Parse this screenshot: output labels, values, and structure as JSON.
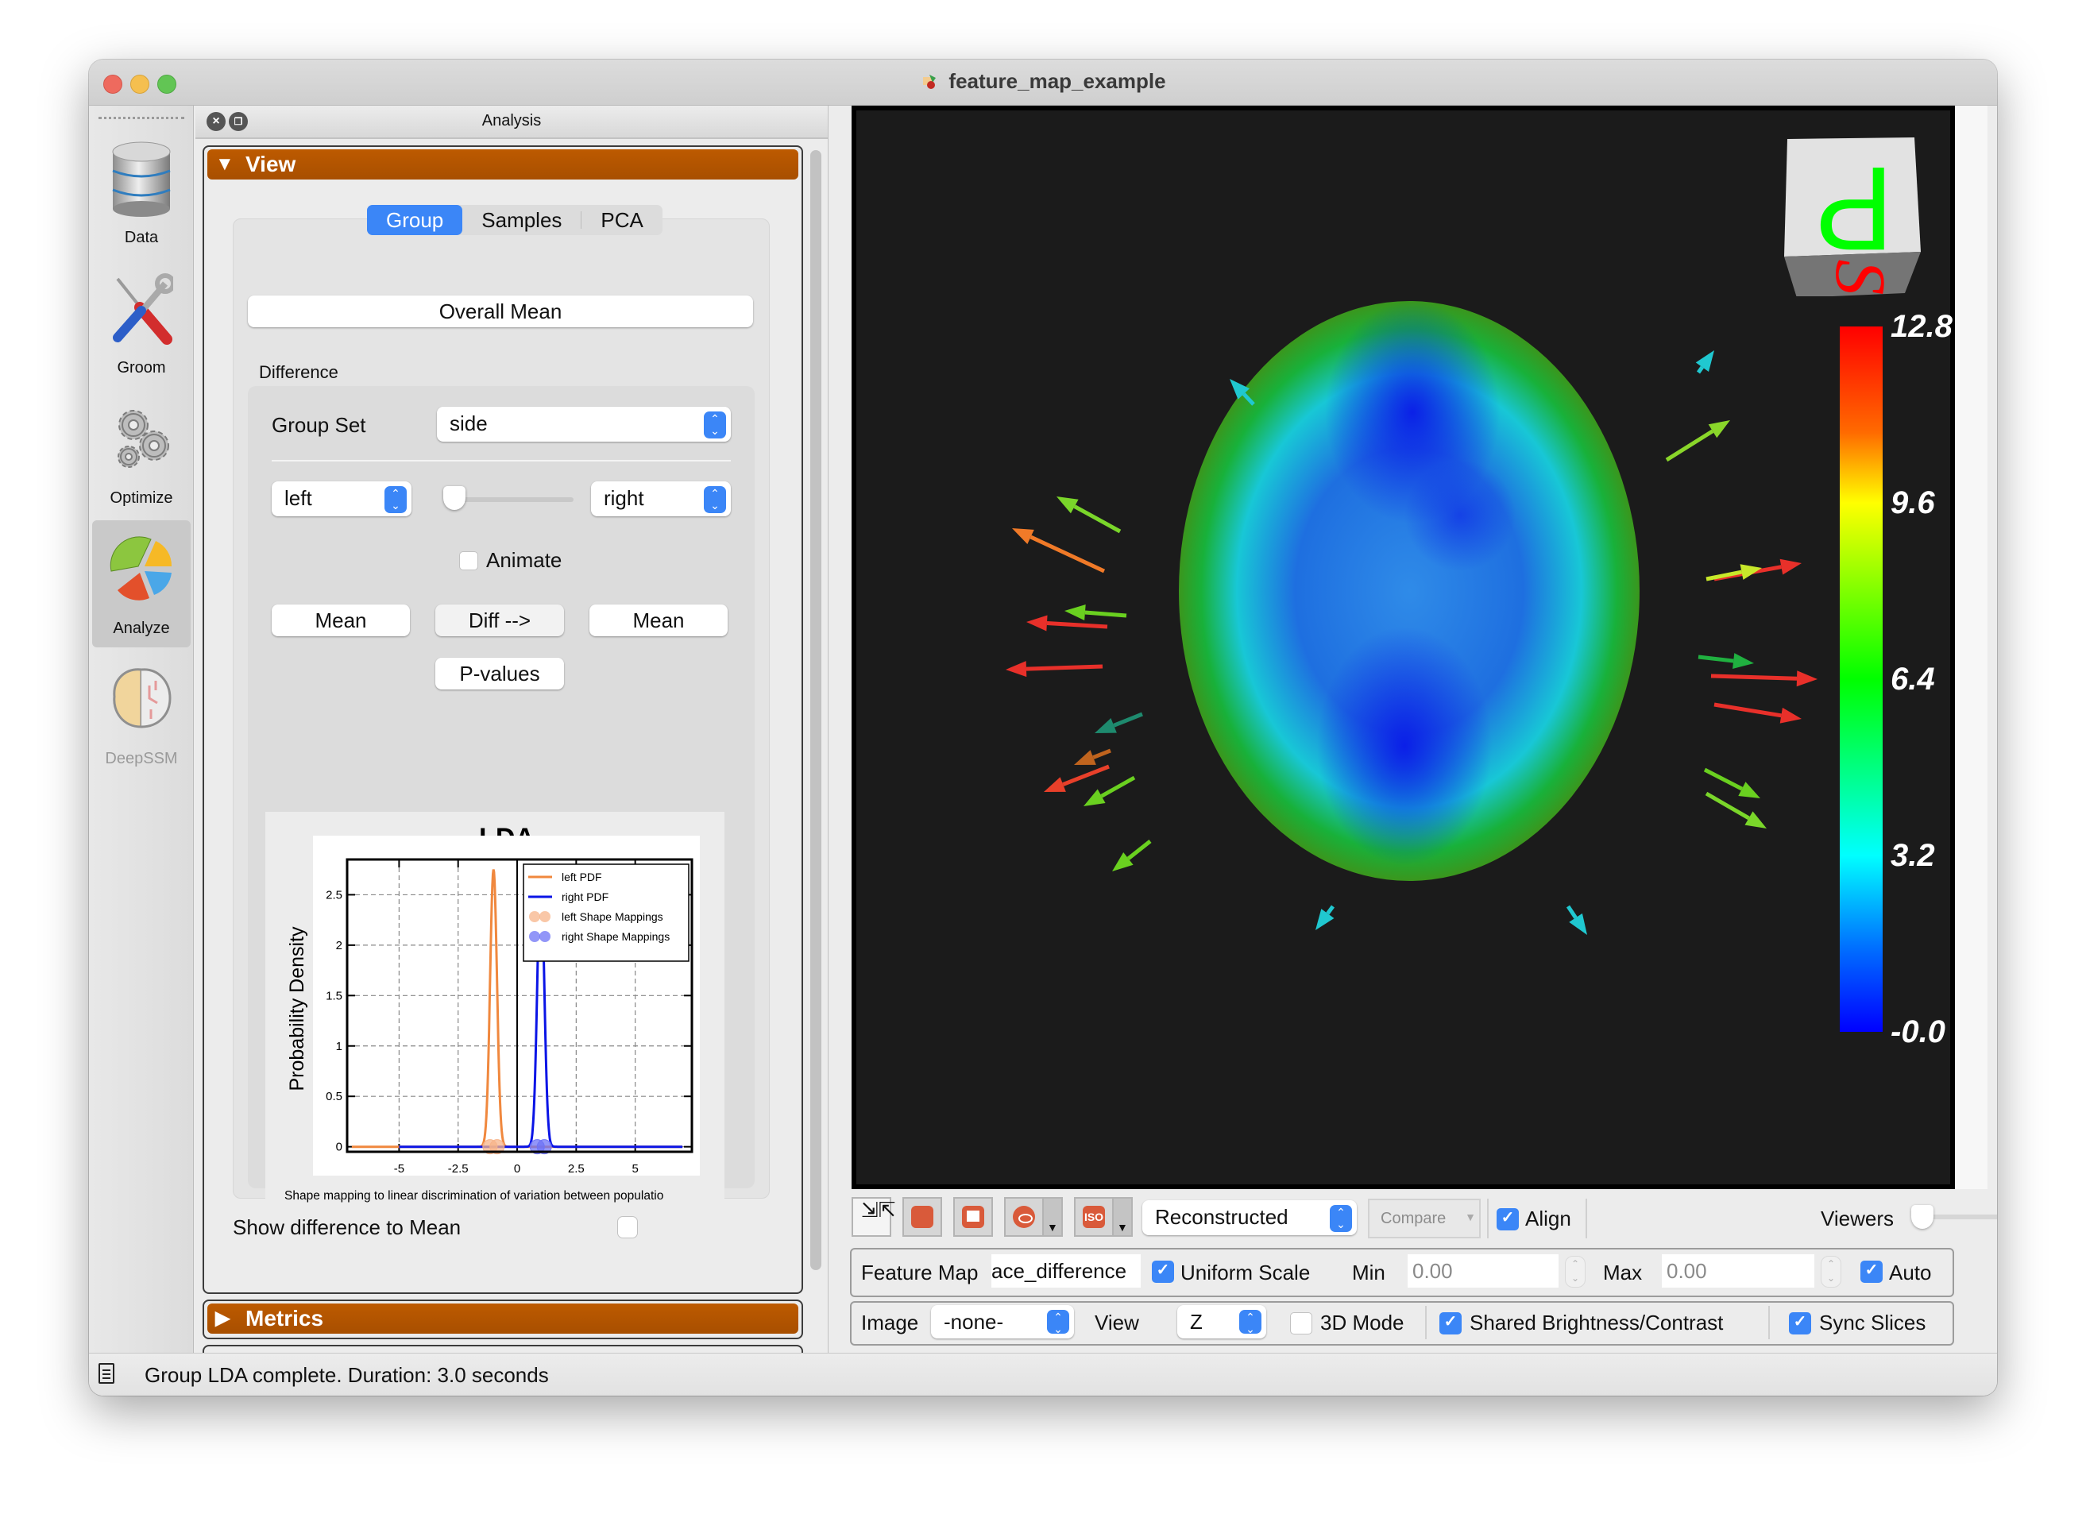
{
  "window": {
    "title": "feature_map_example"
  },
  "sidebar": {
    "items": [
      {
        "label": "Data",
        "icon": "database-icon",
        "active": false,
        "enabled": true
      },
      {
        "label": "Groom",
        "icon": "tools-icon",
        "active": false,
        "enabled": true
      },
      {
        "label": "Optimize",
        "icon": "gears-icon",
        "active": false,
        "enabled": true
      },
      {
        "label": "Analyze",
        "icon": "pie-chart-icon",
        "active": true,
        "enabled": true
      },
      {
        "label": "DeepSSM",
        "icon": "brain-icon",
        "active": false,
        "enabled": false
      }
    ]
  },
  "panel": {
    "title": "Analysis",
    "view_section": {
      "label": "View",
      "expanded": true
    },
    "metrics_section": {
      "label": "Metrics",
      "expanded": false
    },
    "tabs": [
      {
        "label": "Group",
        "active": true
      },
      {
        "label": "Samples",
        "active": false
      },
      {
        "label": "PCA",
        "active": false
      }
    ],
    "overall_mean_label": "Overall Mean",
    "difference_label": "Difference",
    "group_set_label": "Group Set",
    "group_set_value": "side",
    "left_group_value": "left",
    "right_group_value": "right",
    "group_slider_value": 0,
    "animate_label": "Animate",
    "animate_checked": false,
    "left_mean_label": "Mean",
    "diff_label": "Diff -->",
    "right_mean_label": "Mean",
    "pvalues_label": "P-values",
    "show_diff_label": "Show difference to Mean",
    "show_diff_checked": false
  },
  "chart_data": {
    "type": "line",
    "title": "LDA",
    "xlabel": "Shape mapping to linear discrimination of variation between populatio",
    "ylabel": "Probability Density",
    "xlim": [
      -7.2,
      7.4
    ],
    "ylim": [
      -0.05,
      2.85
    ],
    "xticks": [
      -5,
      -2.5,
      0,
      2.5,
      5
    ],
    "xtick_labels": [
      "-5",
      "-2.5",
      "0",
      "2.5",
      "5"
    ],
    "yticks": [
      0,
      0.5,
      1,
      1.5,
      2,
      2.5
    ],
    "ytick_labels": [
      "0",
      "0.5",
      "1",
      "1.5",
      "2",
      "2.5"
    ],
    "grid": true,
    "legend_position": "top-right",
    "series": [
      {
        "name": "left PDF",
        "kind": "pdf",
        "color": "#f0883e",
        "mean": -1.0,
        "sd": 0.145,
        "x_range": [
          -7.0,
          7.0
        ]
      },
      {
        "name": "right PDF",
        "kind": "pdf",
        "color": "#0a14e6",
        "mean": 1.0,
        "sd": 0.145,
        "x_range": [
          -5.0,
          7.0
        ]
      },
      {
        "name": "left Shape Mappings",
        "kind": "points",
        "color": "#f7b48a",
        "x": [
          -1.15,
          -0.85
        ],
        "y": [
          0,
          0
        ]
      },
      {
        "name": "right Shape Mappings",
        "kind": "points",
        "color": "#6e73f5",
        "x": [
          0.85,
          1.15
        ],
        "y": [
          0,
          0
        ]
      }
    ]
  },
  "viewer": {
    "orientation_cube": {
      "top_letter": "P",
      "front_letter": "S"
    },
    "colorbar": {
      "min": -0.0,
      "max": 12.8,
      "labels": [
        "12.8",
        "9.6",
        "6.4",
        "3.2",
        "-0.0"
      ]
    }
  },
  "toolbar": {
    "buttons": [
      {
        "name": "autofit-icon"
      },
      {
        "name": "surface-icon"
      },
      {
        "name": "landmarks-flag-icon"
      },
      {
        "name": "visibility-eye-icon",
        "dropdown": true
      },
      {
        "name": "iso-icon",
        "label": "ISO",
        "dropdown": true
      }
    ],
    "display_mode_value": "Reconstructed",
    "compare_label": "Compare",
    "align_label": "Align",
    "align_checked": true,
    "viewers_label": "Viewers",
    "viewers_slider_value": 1
  },
  "feature_row": {
    "feature_map_label": "Feature Map",
    "feature_map_value": "ace_difference",
    "uniform_scale_label": "Uniform Scale",
    "uniform_scale_checked": true,
    "min_label": "Min",
    "min_value": "0.00",
    "max_label": "Max",
    "max_value": "0.00",
    "auto_label": "Auto",
    "auto_checked": true
  },
  "image_row": {
    "image_label": "Image",
    "image_value": "-none-",
    "view_label": "View",
    "view_value": "Z",
    "mode3d_label": "3D Mode",
    "mode3d_checked": false,
    "shared_bc_label": "Shared Brightness/Contrast",
    "shared_bc_checked": true,
    "sync_slices_label": "Sync Slices",
    "sync_slices_checked": true
  },
  "status": {
    "message": "Group LDA complete. Duration: 3.0 seconds"
  }
}
